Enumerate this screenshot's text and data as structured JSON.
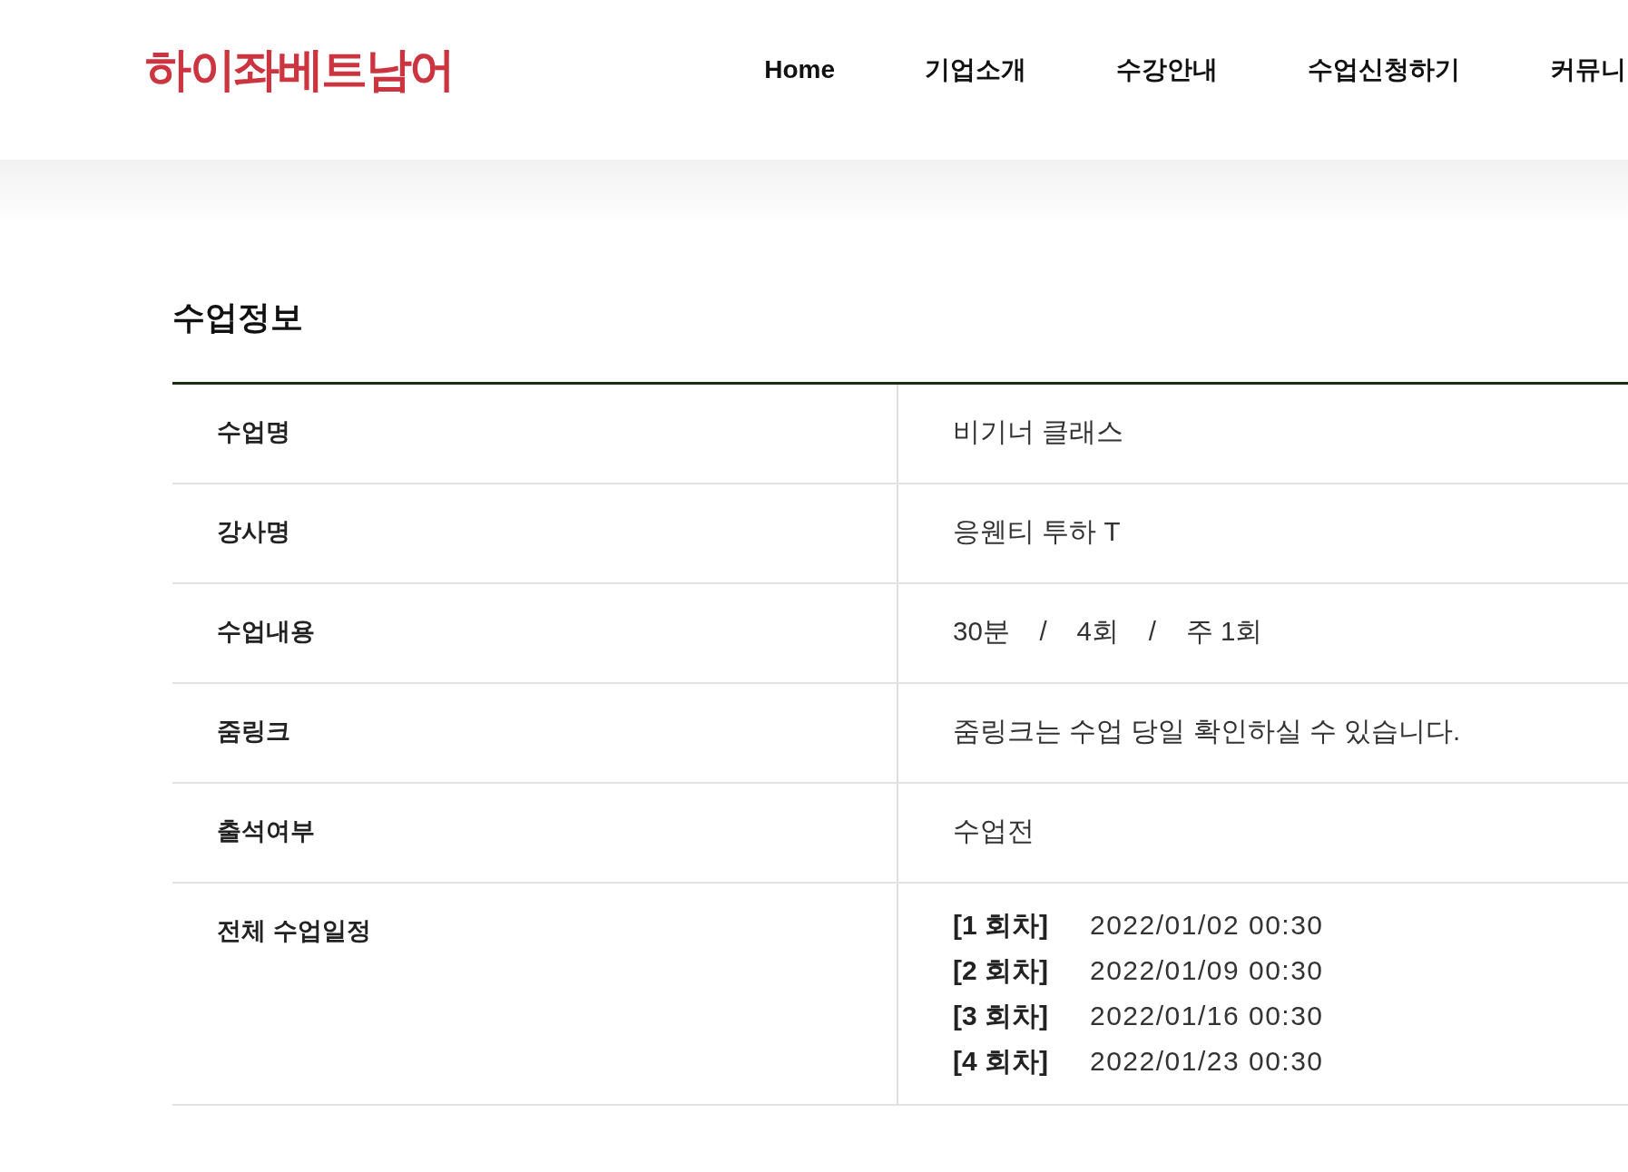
{
  "header": {
    "logo": "하이좌베트남어",
    "nav": [
      "Home",
      "기업소개",
      "수강안내",
      "수업신청하기",
      "커뮤니"
    ]
  },
  "section_title": "수업정보",
  "info_rows": [
    {
      "kind": "text",
      "label": "수업명",
      "value": "비기너 클래스"
    },
    {
      "kind": "text",
      "label": "강사명",
      "value": "응웬티 투하 T"
    },
    {
      "kind": "text",
      "label": "수업내용",
      "value": "30분    /    4회    /    주 1회"
    },
    {
      "kind": "text",
      "label": "줌링크",
      "value": "줌링크는 수업 당일 확인하실 수 있습니다."
    },
    {
      "kind": "text",
      "label": "출석여부",
      "value": "수업전"
    },
    {
      "kind": "schedule",
      "label": "전체 수업일정",
      "schedule": [
        {
          "round": "[1 회차]",
          "datetime": "2022/01/02 00:30"
        },
        {
          "round": "[2 회차]",
          "datetime": "2022/01/09 00:30"
        },
        {
          "round": "[3 회차]",
          "datetime": "2022/01/16 00:30"
        },
        {
          "round": "[4 회차]",
          "datetime": "2022/01/23 00:30"
        }
      ]
    }
  ]
}
